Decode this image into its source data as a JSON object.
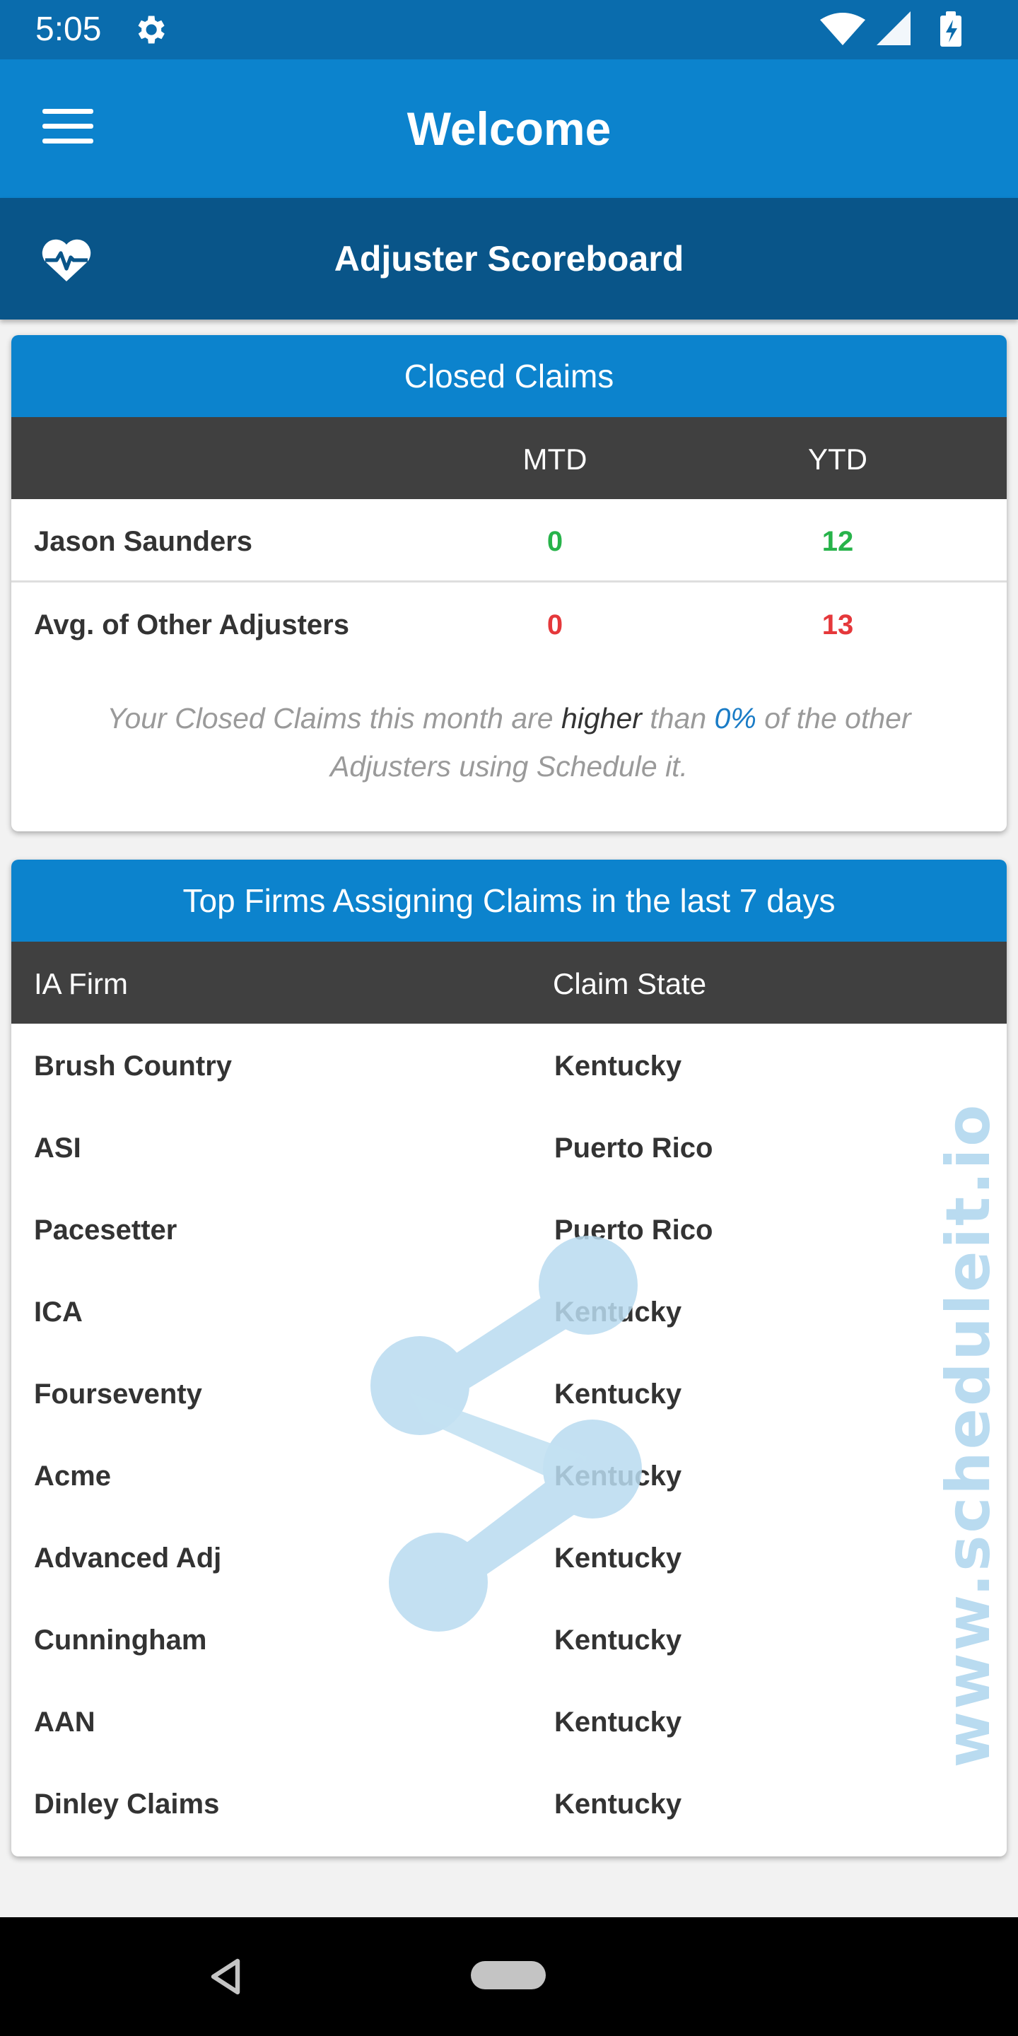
{
  "status_bar": {
    "time": "5:05",
    "icons": [
      "gear-icon",
      "wifi-icon",
      "signal-icon",
      "battery-charging-icon"
    ]
  },
  "app_bar": {
    "title": "Welcome",
    "menu_icon": "hamburger-menu-icon"
  },
  "sub_bar": {
    "title": "Adjuster Scoreboard",
    "icon": "heart-pulse-icon"
  },
  "closed_claims": {
    "title": "Closed Claims",
    "columns": [
      "",
      "MTD",
      "YTD"
    ],
    "rows": [
      {
        "name": "Jason Saunders",
        "mtd": "0",
        "ytd": "12",
        "color": "#27b34a"
      },
      {
        "name": "Avg. of Other Adjusters",
        "mtd": "0",
        "ytd": "13",
        "color": "#e5383b"
      }
    ],
    "note": {
      "part1": "Your Closed Claims this month are ",
      "emphasis": "higher",
      "part2": " than ",
      "percent": "0%",
      "part3": " of the other Adjusters using Schedule it."
    }
  },
  "top_firms": {
    "title": "Top Firms Assigning Claims in the last 7 days",
    "columns": [
      "IA Firm",
      "Claim State"
    ],
    "rows": [
      {
        "firm": "Brush Country",
        "state": "Kentucky"
      },
      {
        "firm": "ASI",
        "state": "Puerto Rico"
      },
      {
        "firm": "Pacesetter",
        "state": "Puerto Rico"
      },
      {
        "firm": "ICA",
        "state": "Kentucky"
      },
      {
        "firm": "Fourseventy",
        "state": "Kentucky"
      },
      {
        "firm": "Acme",
        "state": "Kentucky"
      },
      {
        "firm": "Advanced Adj",
        "state": "Kentucky"
      },
      {
        "firm": "Cunningham",
        "state": "Kentucky"
      },
      {
        "firm": "AAN",
        "state": "Kentucky"
      },
      {
        "firm": "Dinley Claims",
        "state": "Kentucky"
      }
    ]
  },
  "watermark": {
    "text": "www.scheduleit.io",
    "color": "#b9dbf0"
  },
  "nav_bar": {
    "icons": [
      "back-icon",
      "home-pill-icon"
    ]
  },
  "colors": {
    "status_bar": "#0a6cad",
    "app_bar": "#0c83cd",
    "sub_bar": "#095589",
    "table_header": "#404040",
    "good": "#27b34a",
    "bad": "#e5383b"
  }
}
